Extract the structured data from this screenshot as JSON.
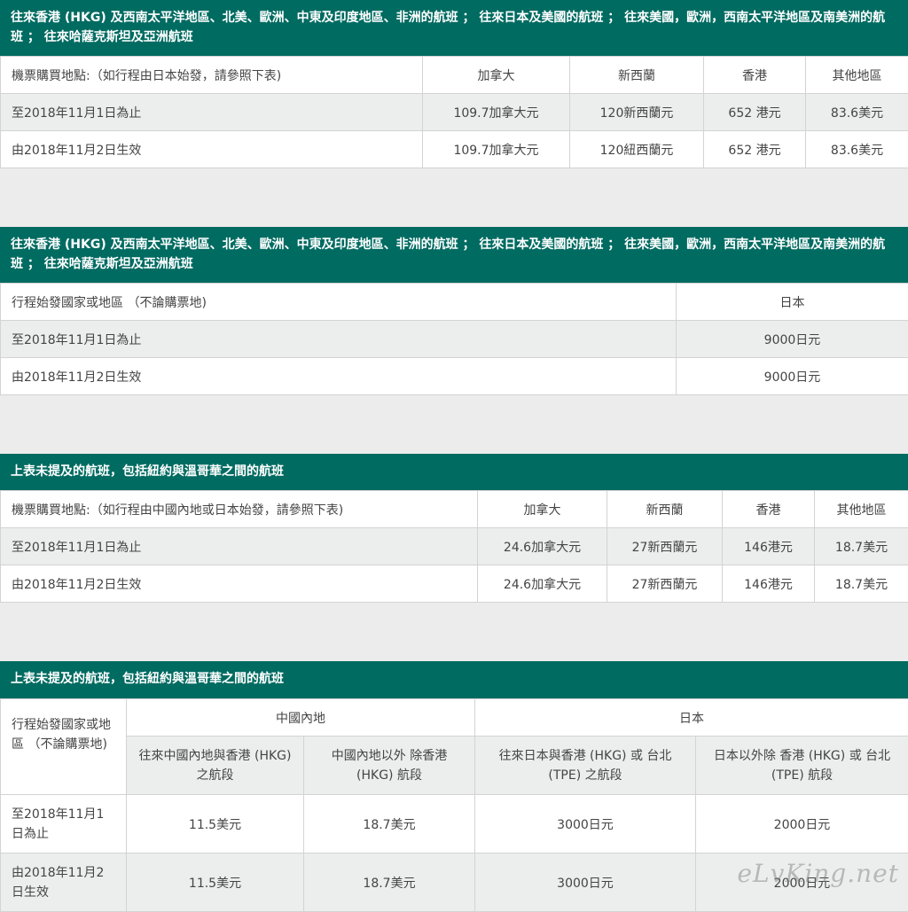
{
  "section1": {
    "header": "往來香港 (HKG) 及西南太平洋地區、北美、歐洲、中東及印度地區、非洲的航班 ； 往來日本及美國的航班 ； 往來美國，歐洲，西南太平洋地區及南美洲的航班 ； 往來哈薩克斯坦及亞洲航班",
    "columns": [
      "機票購買地點:（如行程由日本始發，請參照下表)",
      "加拿大",
      "新西蘭",
      "香港",
      "其他地區"
    ],
    "rows": [
      [
        "至2018年11月1日為止",
        "109.7加拿大元",
        "120新西蘭元",
        "652 港元",
        "83.6美元"
      ],
      [
        "由2018年11月2日生效",
        "109.7加拿大元",
        "120紐西蘭元",
        "652 港元",
        "83.6美元"
      ]
    ]
  },
  "section2": {
    "header": "往來香港 (HKG) 及西南太平洋地區、北美、歐洲、中東及印度地區、非洲的航班 ； 往來日本及美國的航班 ； 往來美國，歐洲，西南太平洋地區及南美洲的航班 ； 往來哈薩克斯坦及亞洲航班",
    "columns": [
      "行程始發國家或地區 （不論購票地)",
      "日本"
    ],
    "rows": [
      [
        "至2018年11月1日為止",
        "9000日元"
      ],
      [
        "由2018年11月2日生效",
        "9000日元"
      ]
    ]
  },
  "section3": {
    "header": "上表未提及的航班，包括紐約與溫哥華之間的航班",
    "columns": [
      "機票購買地點:（如行程由中國內地或日本始發，請參照下表)",
      "加拿大",
      "新西蘭",
      "香港",
      "其他地區"
    ],
    "rows": [
      [
        "至2018年11月1日為止",
        "24.6加拿大元",
        "27新西蘭元",
        "146港元",
        "18.7美元"
      ],
      [
        "由2018年11月2日生效",
        "24.6加拿大元",
        "27新西蘭元",
        "146港元",
        "18.7美元"
      ]
    ]
  },
  "section4": {
    "header": "上表未提及的航班，包括紐約與溫哥華之間的航班",
    "corner": "行程始發國家或地區 （不論購票地)",
    "group1": "中國內地",
    "group2": "日本",
    "subcols": [
      "往來中國內地與香港 (HKG) 之航段",
      "中國內地以外 除香港 (HKG) 航段",
      "往來日本與香港 (HKG) 或 台北 (TPE) 之航段",
      "日本以外除 香港 (HKG) 或 台北 (TPE) 航段"
    ],
    "rows": [
      [
        "至2018年11月1日為止",
        "11.5美元",
        "18.7美元",
        "3000日元",
        "2000日元"
      ],
      [
        "由2018年11月2日生效",
        "11.5美元",
        "18.7美元",
        "3000日元",
        "2000日元"
      ]
    ]
  },
  "watermark": "eLvKing.net"
}
